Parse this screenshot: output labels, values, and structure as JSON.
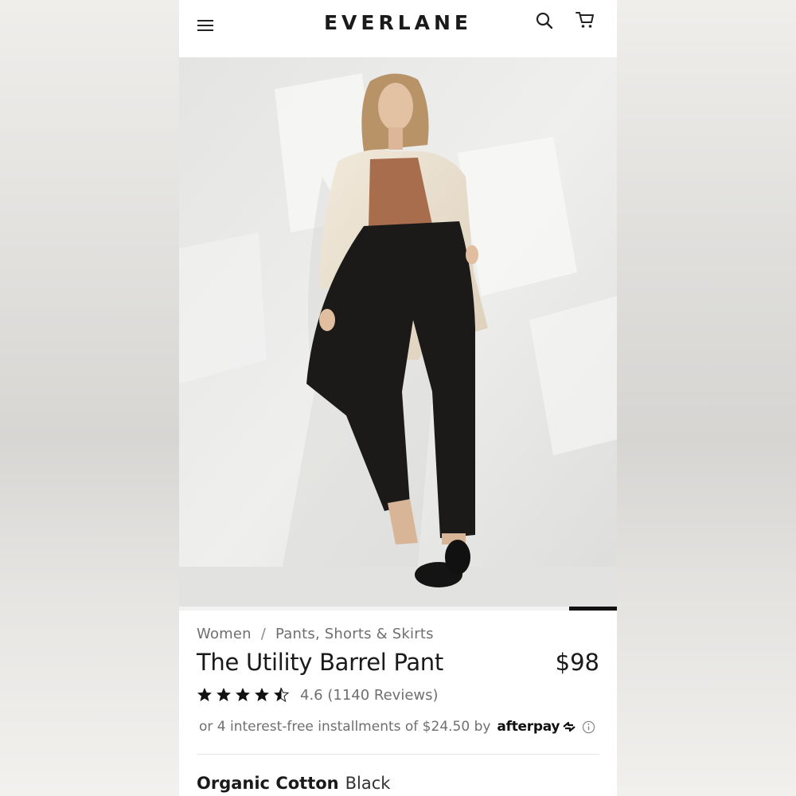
{
  "header": {
    "logo": "EVERLANE",
    "icons": [
      "menu-icon",
      "search-icon",
      "cart-icon"
    ]
  },
  "gallery": {
    "progress": 0.11
  },
  "breadcrumb": {
    "items": [
      "Women",
      "Pants, Shorts & Skirts"
    ],
    "separator": "/"
  },
  "product": {
    "title": "The Utility Barrel Pant",
    "price": "$98",
    "rating": {
      "value": 4.6,
      "stars_filled": 4.5,
      "text": "4.6 (1140 Reviews)"
    },
    "installments": {
      "text": "or 4 interest-free installments of $24.50 by",
      "provider": "afterpay"
    },
    "material": {
      "label": "Organic Cotton",
      "color": "Black"
    }
  },
  "colors": {
    "text_primary": "#1a1a1a",
    "text_secondary": "#6f6f6f",
    "progress": "#111111"
  }
}
